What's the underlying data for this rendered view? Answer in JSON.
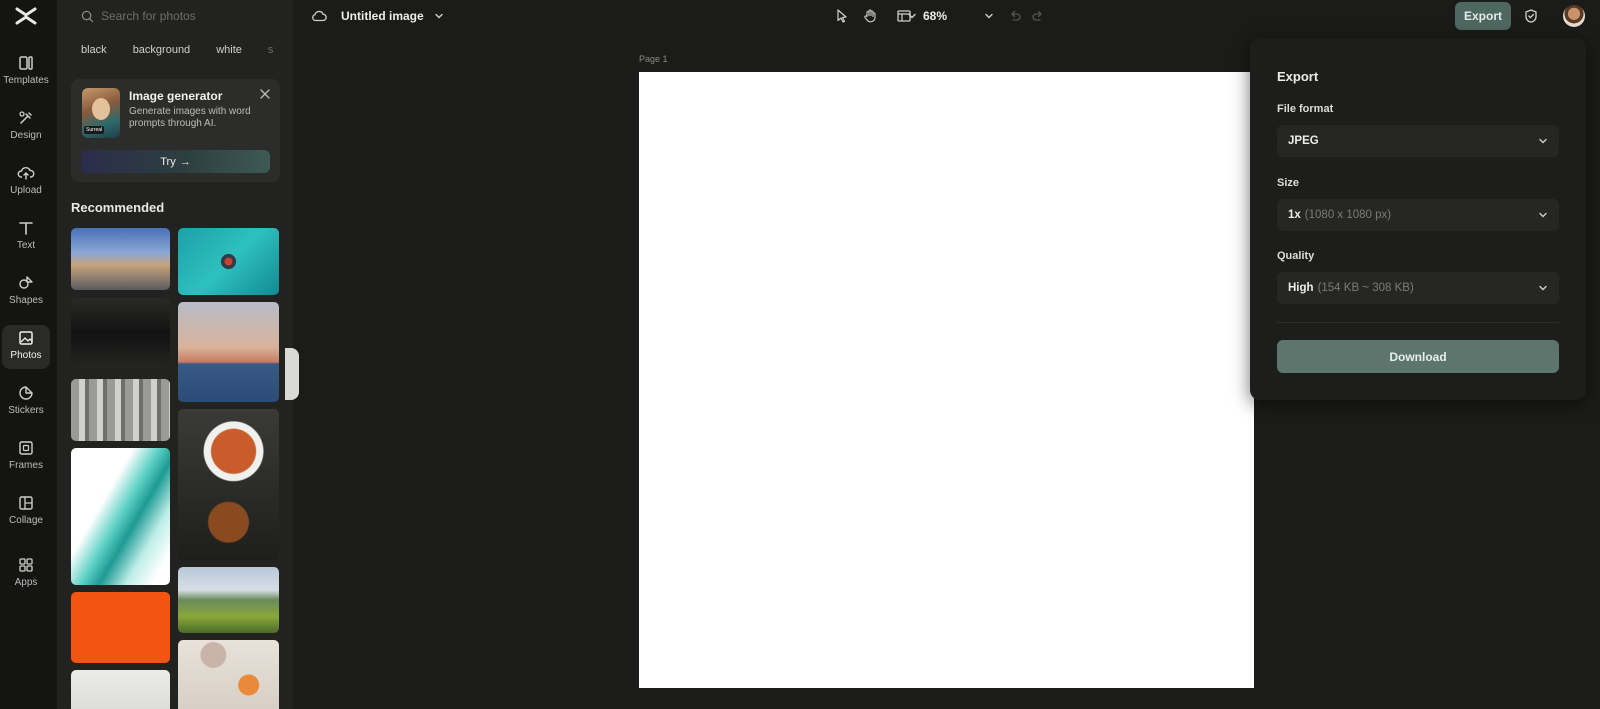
{
  "rail": {
    "items": [
      {
        "label": "Templates",
        "icon": "templates-icon"
      },
      {
        "label": "Design",
        "icon": "design-icon"
      },
      {
        "label": "Upload",
        "icon": "upload-icon"
      },
      {
        "label": "Text",
        "icon": "text-icon"
      },
      {
        "label": "Shapes",
        "icon": "shapes-icon"
      },
      {
        "label": "Photos",
        "icon": "photos-icon"
      },
      {
        "label": "Stickers",
        "icon": "stickers-icon"
      },
      {
        "label": "Frames",
        "icon": "frames-icon"
      },
      {
        "label": "Collage",
        "icon": "collage-icon"
      },
      {
        "label": "Apps",
        "icon": "apps-icon"
      }
    ],
    "active": "Photos"
  },
  "panel": {
    "search_placeholder": "Search for photos",
    "chips": [
      "black",
      "background",
      "white",
      "s"
    ],
    "generator": {
      "title": "Image generator",
      "description": "Generate images with word prompts through AI.",
      "thumb_tag": "Surreal",
      "try_label": "Try"
    },
    "recommended_title": "Recommended"
  },
  "topbar": {
    "doc_title": "Untitled image",
    "zoom": "68%",
    "export_label": "Export"
  },
  "canvas": {
    "page_label": "Page 1"
  },
  "export_panel": {
    "title": "Export",
    "file_format_label": "File format",
    "file_format_value": "JPEG",
    "size_label": "Size",
    "size_value": "1x",
    "size_detail": "(1080 x 1080 px)",
    "quality_label": "Quality",
    "quality_value": "High",
    "quality_detail": "(154 KB ~ 308 KB)",
    "download_label": "Download"
  },
  "colors": {
    "accent_button": "#5c766e",
    "background": "#1b1b19",
    "canvas": "#ffffff"
  }
}
